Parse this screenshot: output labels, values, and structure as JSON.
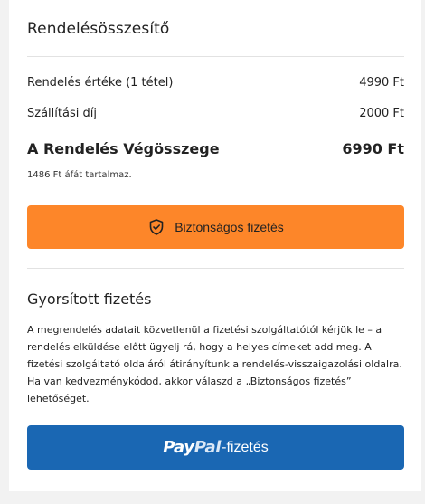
{
  "summary": {
    "title": "Rendelésösszesítő",
    "order_value_label": "Rendelés értéke (1 tétel)",
    "order_value": "4990 Ft",
    "shipping_label": "Szállítási díj",
    "shipping_value": "2000 Ft",
    "total_label": "A Rendelés Végösszege",
    "total_value": "6990 Ft",
    "vat_note": "1486 Ft áfát tartalmaz."
  },
  "secure_button": {
    "label": "Biztonságos fizetés",
    "icon": "shield-check-icon",
    "color": "#fd8629"
  },
  "fast_checkout": {
    "title": "Gyorsított fizetés",
    "description": "A megrendelés adatait közvetlenül a fizetési szolgáltatótól kérjük le – a rendelés elküldése előtt ügyelj rá, hogy a helyes címeket add meg. A fizetési szolgáltató oldaláról átirányítunk a rendelés-visszaigazolási oldalra. Ha van kedvezménykódod, akkor válaszd a „Biztonságos fizetés” lehetőséget."
  },
  "paypal_button": {
    "logo_pay": "Pay",
    "logo_pal": "Pal",
    "suffix": "-fizetés",
    "color": "#1a67b3"
  }
}
